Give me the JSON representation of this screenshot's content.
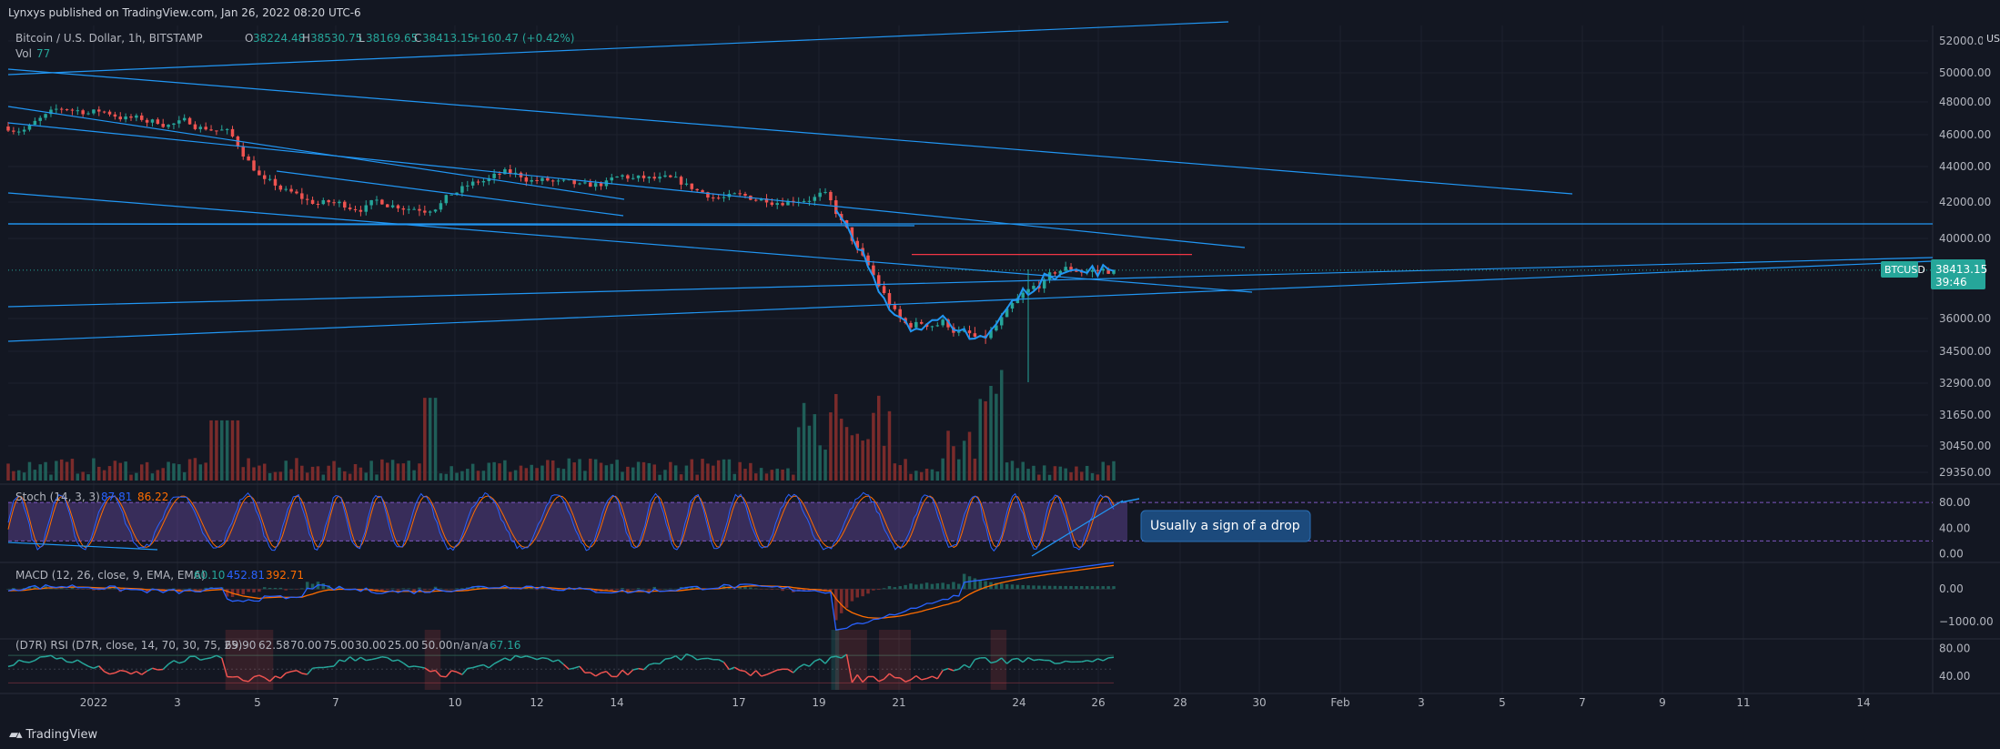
{
  "header": {
    "published": "Lynxys published on TradingView.com, Jan 26, 2022 08:20 UTC-6"
  },
  "footer": {
    "brand": "TradingView"
  },
  "legend": {
    "symbol": "Bitcoin / U.S. Dollar, 1h, BITSTAMP",
    "o_label": "O",
    "o_value": "38224.48",
    "h_label": "H",
    "h_value": "38530.75",
    "l_label": "L",
    "l_value": "38169.65",
    "c_label": "C",
    "c_value": "38413.15",
    "change": "+160.47 (+0.42%)",
    "vol_label": "Vol",
    "vol_value": "77"
  },
  "currency": "USD",
  "price_tag": {
    "symbol": "BTCUSD",
    "price": "38413.15",
    "countdown": "39:46"
  },
  "annotation": "Usually a sign of a drop",
  "colors": {
    "background": "#131722",
    "up": "#26a69a",
    "down": "#ef5350",
    "trendline": "#2196f3",
    "resistance": "#f23645",
    "macd": "#2962ff",
    "signal": "#ff6d00",
    "stoch_band": "#7e57c2",
    "text": "#b2b5be"
  },
  "chart_data": [
    {
      "type": "candlestick",
      "title": "Bitcoin / U.S. Dollar, 1h, BITSTAMP",
      "x_ticks": [
        "2022",
        "3",
        "5",
        "7",
        "10",
        "12",
        "14",
        "17",
        "19",
        "21",
        "24",
        "26",
        "28",
        "30",
        "Feb",
        "3",
        "5",
        "7",
        "9",
        "11",
        "14"
      ],
      "y_ticks": [
        "52000.00",
        "50000.00",
        "48000.00",
        "46000.00",
        "44000.00",
        "42000.00",
        "40000.00",
        "36000.00",
        "34500.00",
        "32900.00",
        "31650.00",
        "30450.00",
        "29350.00"
      ],
      "ylim": [
        29000,
        52600
      ],
      "price_path": {
        "x": [
          "Dec 31",
          "Jan 1",
          "Jan 2",
          "Jan 3",
          "Jan 4",
          "Jan 5",
          "Jan 6",
          "Jan 7",
          "Jan 8",
          "Jan 9",
          "Jan 10",
          "Jan 11",
          "Jan 12",
          "Jan 13",
          "Jan 14",
          "Jan 15",
          "Jan 16",
          "Jan 17",
          "Jan 18",
          "Jan 19",
          "Jan 20",
          "Jan 21",
          "Jan 22",
          "Jan 23",
          "Jan 24",
          "Jan 25",
          "Jan 26"
        ],
        "close": [
          46500,
          47500,
          47400,
          46800,
          46700,
          46300,
          43100,
          42000,
          41800,
          42000,
          41800,
          42800,
          43500,
          43200,
          42600,
          43300,
          43100,
          42500,
          42100,
          42300,
          42500,
          38800,
          35600,
          35900,
          34800,
          36900,
          38413
        ]
      },
      "overlay_series": {
        "name": "",
        "color": "#2196f3",
        "range": [
          "Jan 21",
          "Jan 26"
        ]
      },
      "volume_max": 6100,
      "levels": [
        {
          "label": "horizontal",
          "price": 40700
        },
        {
          "label": "resistance",
          "price": 39200,
          "color": "#f23645"
        }
      ]
    },
    {
      "type": "line",
      "title": "Stoch (14, 3, 3)",
      "values_shown": [
        "87.81",
        "86.22"
      ],
      "y_ticks": [
        "80.00",
        "40.00",
        "0.00"
      ],
      "ylim": [
        -5,
        100
      ],
      "band": [
        20,
        80
      ]
    },
    {
      "type": "line",
      "title": "MACD (12, 26, close, 9, EMA, EMA)",
      "values_shown": [
        "60.10",
        "452.81",
        "392.71"
      ],
      "y_ticks": [
        "0.00",
        "−1000.00"
      ],
      "ylim": [
        -1300,
        700
      ]
    },
    {
      "type": "line",
      "title": "(D7R) RSI",
      "params": "(D7R, close, 14, 70, 30, 75, 25)",
      "values_shown": [
        "69.90",
        "62.58",
        "70.00",
        "75.00",
        "30.00",
        "25.00",
        "50.00",
        "n/a",
        "n/a",
        "67.16"
      ],
      "y_ticks": [
        "80.00",
        "40.00"
      ],
      "ylim": [
        20,
        90
      ]
    }
  ]
}
